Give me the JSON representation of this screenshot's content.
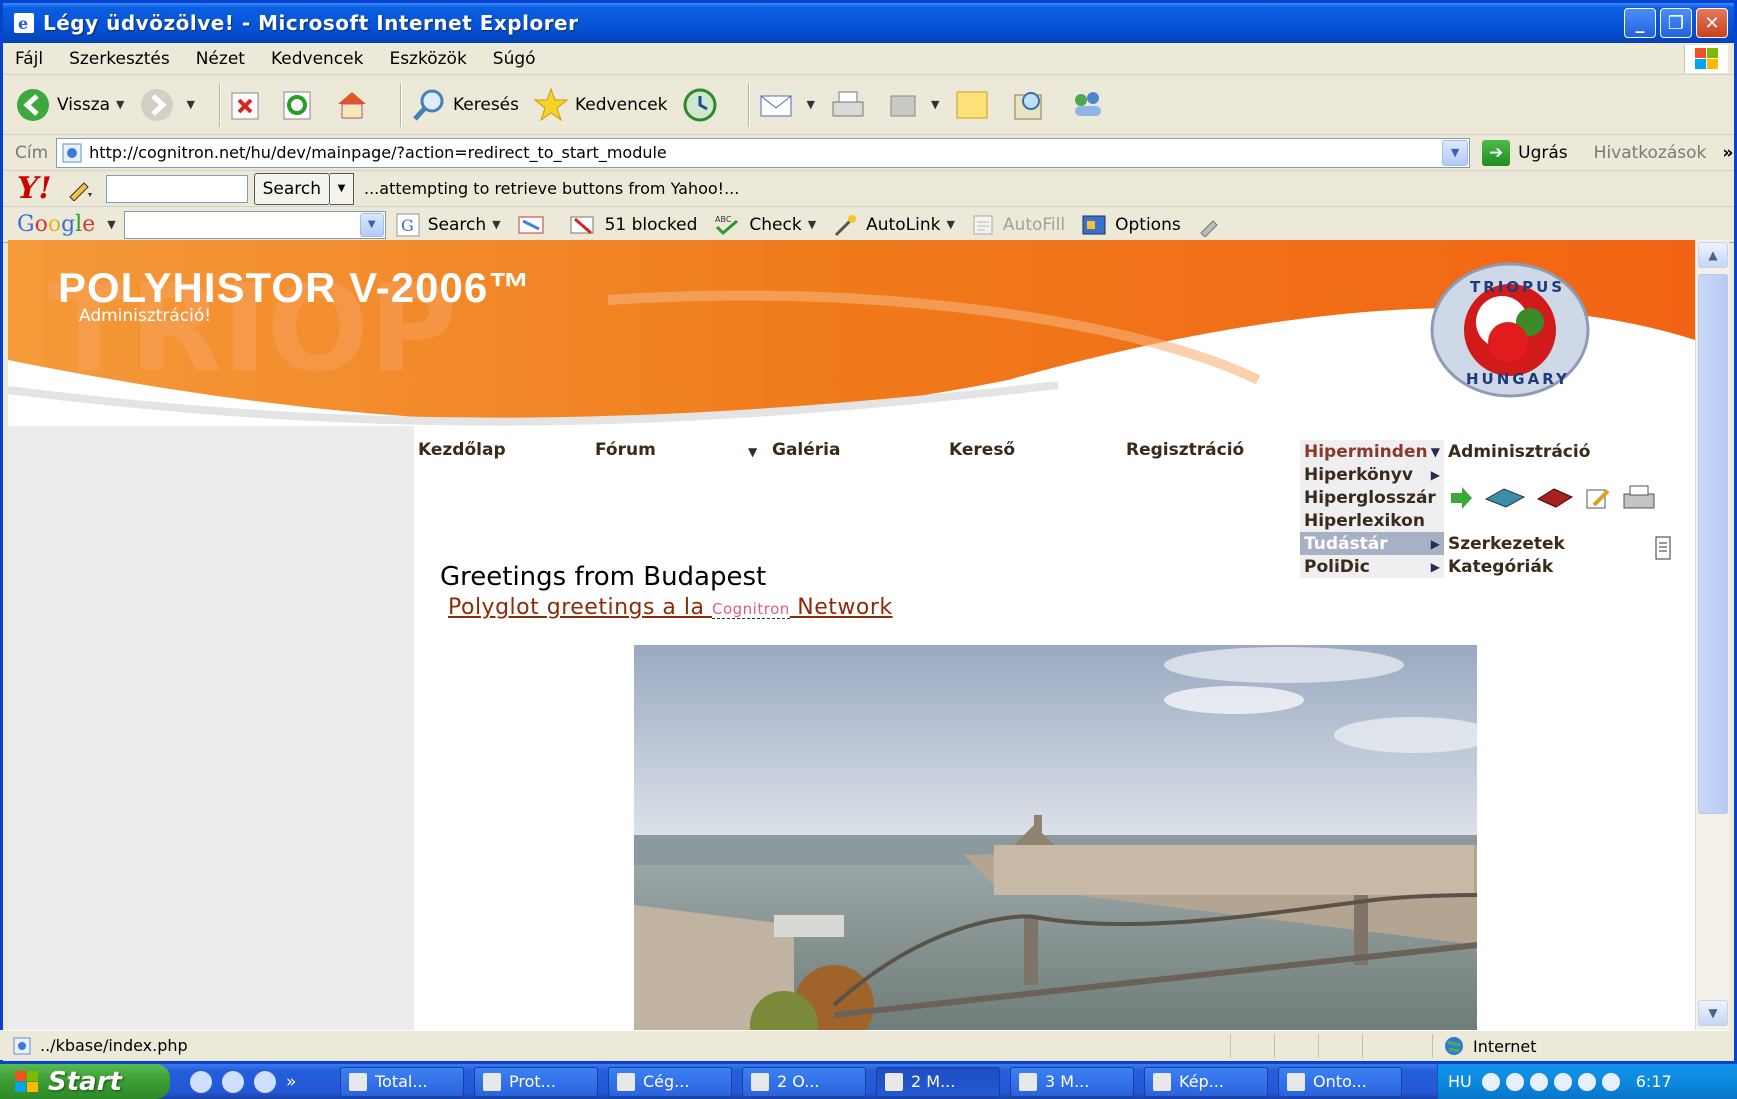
{
  "window": {
    "title": "Légy üdvözölve! - Microsoft Internet Explorer",
    "min": "_",
    "max": "❐",
    "close": "✕"
  },
  "menu": [
    "Fájl",
    "Szerkesztés",
    "Nézet",
    "Kedvencek",
    "Eszközök",
    "Súgó"
  ],
  "toolbar": {
    "back_label": "Vissza",
    "search_label": "Keresés",
    "favorites_label": "Kedvencek"
  },
  "address": {
    "label": "Cím",
    "url": "http://cognitron.net/hu/dev/mainpage/?action=redirect_to_start_module",
    "go_label": "Ugrás",
    "links_label": "Hivatkozások",
    "more": "»"
  },
  "yahoo": {
    "logo": "Y!",
    "search_button": "Search",
    "status": "...attempting to retrieve buttons from Yahoo!..."
  },
  "google": {
    "logo": "Google",
    "search_label": "Search",
    "blocked_label": "51 blocked",
    "check_label": "Check",
    "autolink_label": "AutoLink",
    "autofill_label": "AutoFill",
    "options_label": "Options"
  },
  "site": {
    "title": "POLYHISTOR V-2006™",
    "subtitle": "Adminisztráció!",
    "logo_top": "TRIOPUS",
    "logo_bottom": "HUNGARY",
    "nav": [
      "Kezdőlap",
      "Fórum",
      "Galéria",
      "Kereső",
      "Regisztráció"
    ],
    "menu_items": [
      "Hiperminden",
      "Hiperkönyv",
      "Hiperglosszár",
      "Hiperlexikon",
      "Tudástár",
      "PoliDic"
    ],
    "submenu_top": "Adminisztráció",
    "submenu_items": [
      "Szerkezetek",
      "Kategóriák"
    ],
    "greeting": "Greetings from Budapest",
    "polyglot_pre": "Polyglot greetings a la ",
    "polyglot_brand": "Cognitron",
    "polyglot_post": " Network"
  },
  "status": {
    "text": "../kbase/index.php",
    "zone": "Internet"
  },
  "taskbar": {
    "start": "Start",
    "tasks": [
      "Total...",
      "Prot...",
      "Cég...",
      "2 O...",
      "2 M...",
      "3 M...",
      "Kép...",
      "Onto..."
    ],
    "lang": "HU",
    "clock": "6:17"
  },
  "colors": {
    "accent_orange": "#f07a1a",
    "link_brown": "#8a2c08",
    "xp_blue": "#0553d6"
  }
}
